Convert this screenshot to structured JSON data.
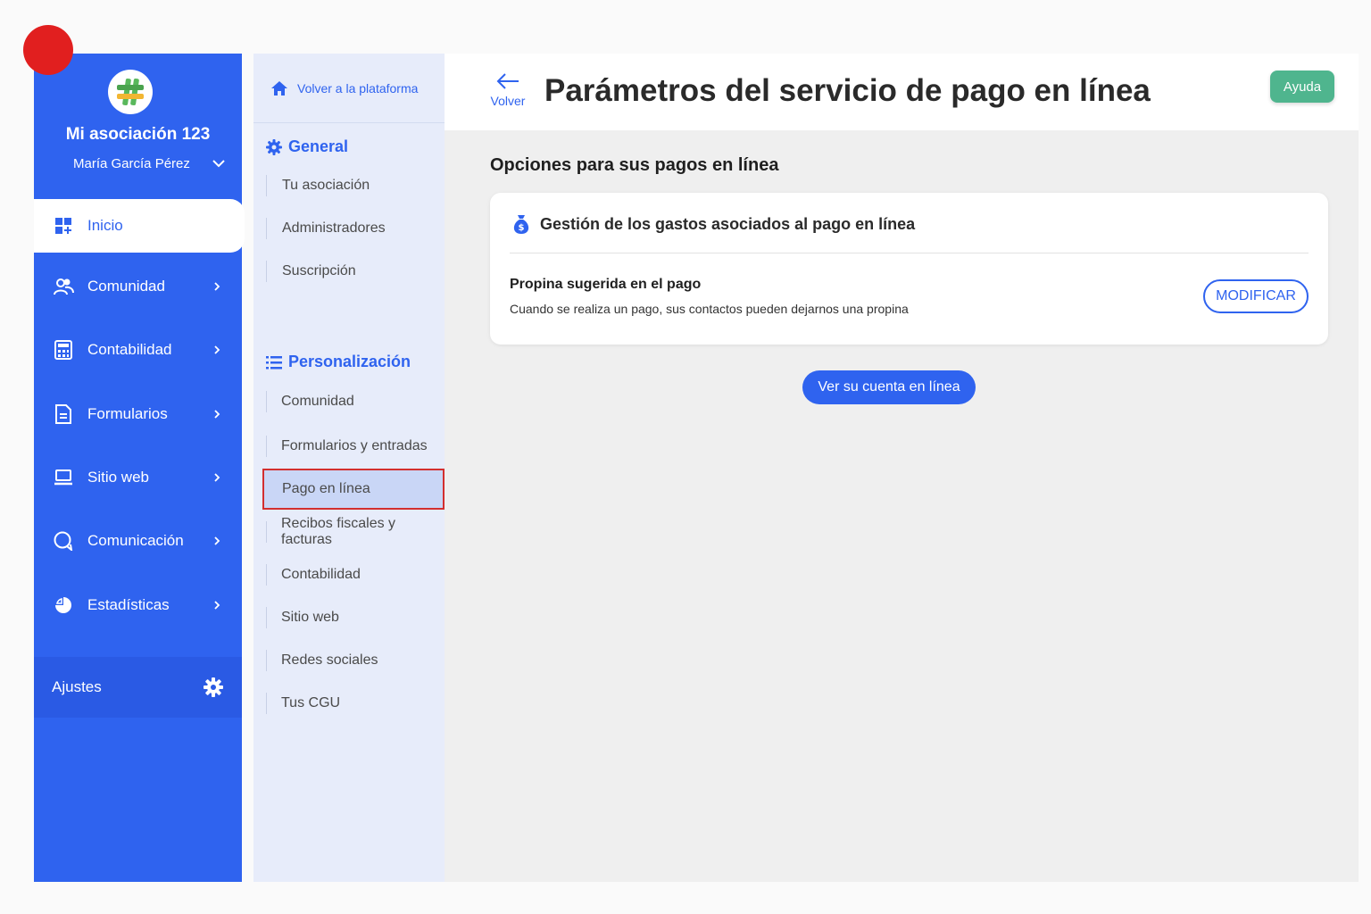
{
  "sidebar": {
    "org_name": "Mi asociación 123",
    "user_name": "María García Pérez",
    "items": [
      {
        "label": "Inicio",
        "icon": "dashboard-icon"
      },
      {
        "label": "Comunidad",
        "icon": "users-icon"
      },
      {
        "label": "Contabilidad",
        "icon": "calculator-icon"
      },
      {
        "label": "Formularios",
        "icon": "document-icon"
      },
      {
        "label": "Sitio web",
        "icon": "laptop-icon"
      },
      {
        "label": "Comunicación",
        "icon": "chat-icon"
      },
      {
        "label": "Estadísticas",
        "icon": "pie-chart-icon"
      }
    ],
    "settings_label": "Ajustes",
    "colors": {
      "primary": "#2f63ef",
      "active_bg": "#ffffff"
    }
  },
  "subnav": {
    "back_label": "Volver a la plataforma",
    "general": {
      "title": "General",
      "items": [
        "Tu asociación",
        "Administradores",
        "Suscripción"
      ]
    },
    "personalization": {
      "title": "Personalización",
      "items": [
        "Comunidad",
        "Formularios y entradas",
        "Pago en línea",
        "Recibos fiscales y facturas",
        "Contabilidad",
        "Sitio web",
        "Redes sociales",
        "Tus CGU"
      ],
      "selected": "Pago en línea"
    }
  },
  "header": {
    "back_label": "Volver",
    "title": "Parámetros del servicio de pago en línea",
    "help_label": "Ayuda",
    "help_color": "#4fb58e"
  },
  "main": {
    "section_title": "Opciones para sus pagos en línea",
    "card": {
      "title": "Gestión de los gastos asociados al pago en línea",
      "option_title": "Propina sugerida en el pago",
      "option_desc": "Cuando se realiza un pago, sus contactos pueden dejarnos una propina",
      "modify_label": "MODIFICAR"
    },
    "account_button_label": "Ver su cuenta en línea"
  }
}
